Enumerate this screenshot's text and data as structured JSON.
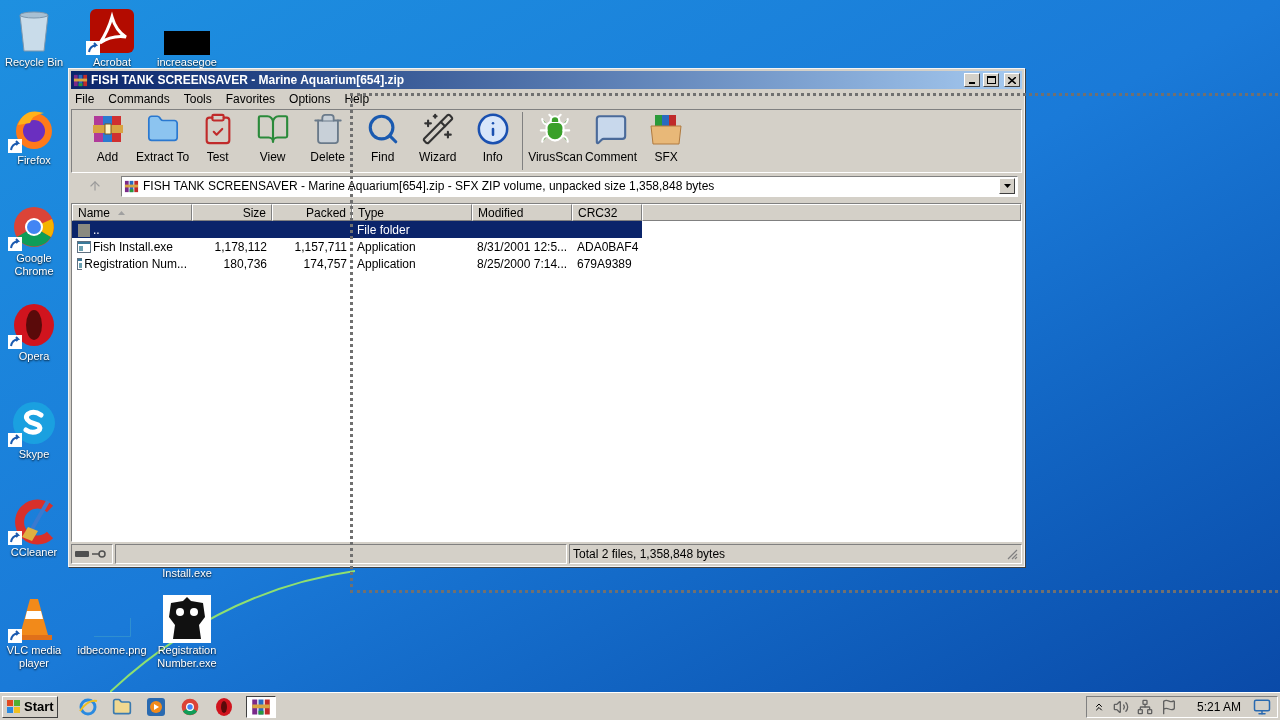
{
  "desktop_icons": [
    {
      "label": "Recycle Bin",
      "kind": "recycle-bin",
      "shortcut": false
    },
    {
      "label": "Firefox",
      "kind": "firefox",
      "shortcut": true
    },
    {
      "label": "Google Chrome",
      "kind": "chrome",
      "shortcut": true
    },
    {
      "label": "Opera",
      "kind": "opera",
      "shortcut": true
    },
    {
      "label": "Skype",
      "kind": "skype",
      "shortcut": true
    },
    {
      "label": "CCleaner",
      "kind": "ccleaner",
      "shortcut": true
    },
    {
      "label": "VLC media player",
      "kind": "vlc",
      "shortcut": true
    },
    {
      "label": "Acrobat",
      "kind": "acrobat",
      "shortcut": true
    },
    {
      "label": "increasegoe",
      "kind": "black-file",
      "shortcut": false
    },
    {
      "label": "idbecome.png",
      "kind": "blank-file",
      "shortcut": false
    },
    {
      "label": "Install.exe",
      "kind": "hidden",
      "shortcut": false
    },
    {
      "label": "Registration Number.exe",
      "kind": "robot",
      "shortcut": false
    }
  ],
  "window": {
    "title": "FISH TANK SCREENSAVER - Marine Aquarium[654].zip",
    "menu": [
      "File",
      "Commands",
      "Tools",
      "Favorites",
      "Options",
      "Help"
    ],
    "toolbar_groups": [
      [
        {
          "label": "Add",
          "kind": "add"
        },
        {
          "label": "Extract To",
          "kind": "extract"
        },
        {
          "label": "Test",
          "kind": "test"
        },
        {
          "label": "View",
          "kind": "view"
        },
        {
          "label": "Delete",
          "kind": "delete"
        },
        {
          "label": "Find",
          "kind": "find"
        },
        {
          "label": "Wizard",
          "kind": "wizard"
        },
        {
          "label": "Info",
          "kind": "info"
        }
      ],
      [
        {
          "label": "VirusScan",
          "kind": "virusscan"
        },
        {
          "label": "Comment",
          "kind": "comment"
        },
        {
          "label": "SFX",
          "kind": "sfx"
        }
      ]
    ],
    "address": "FISH TANK SCREENSAVER - Marine Aquarium[654].zip - SFX ZIP volume, unpacked size 1,358,848 bytes",
    "table": {
      "columns": [
        {
          "label": "Name",
          "sorted": true
        },
        {
          "label": "Size",
          "sorted": false
        },
        {
          "label": "Packed",
          "sorted": false
        },
        {
          "label": "Type",
          "sorted": false
        },
        {
          "label": "Modified",
          "sorted": false
        },
        {
          "label": "CRC32",
          "sorted": false
        }
      ],
      "rows": [
        {
          "kind": "folder",
          "selected": true,
          "cells": [
            "..",
            "",
            "",
            "File folder",
            "",
            ""
          ]
        },
        {
          "kind": "exe",
          "selected": false,
          "cells": [
            "Fish Install.exe",
            "1,178,112",
            "1,157,711",
            "Application",
            "8/31/2001 12:5...",
            "ADA0BAF4"
          ]
        },
        {
          "kind": "exe",
          "selected": false,
          "cells": [
            "Registration Num...",
            "180,736",
            "174,757",
            "Application",
            "8/25/2000 7:14...",
            "679A9389"
          ]
        }
      ]
    },
    "status": "Total 2 files, 1,358,848 bytes"
  },
  "taskbar": {
    "start": "Start",
    "items": [
      {
        "kind": "ie",
        "selected": false
      },
      {
        "kind": "explorer",
        "selected": false
      },
      {
        "kind": "media",
        "selected": false
      },
      {
        "kind": "chrome",
        "selected": false
      },
      {
        "kind": "opera",
        "selected": false
      },
      {
        "kind": "winrar",
        "selected": true
      }
    ],
    "clock": "5:21 AM"
  }
}
